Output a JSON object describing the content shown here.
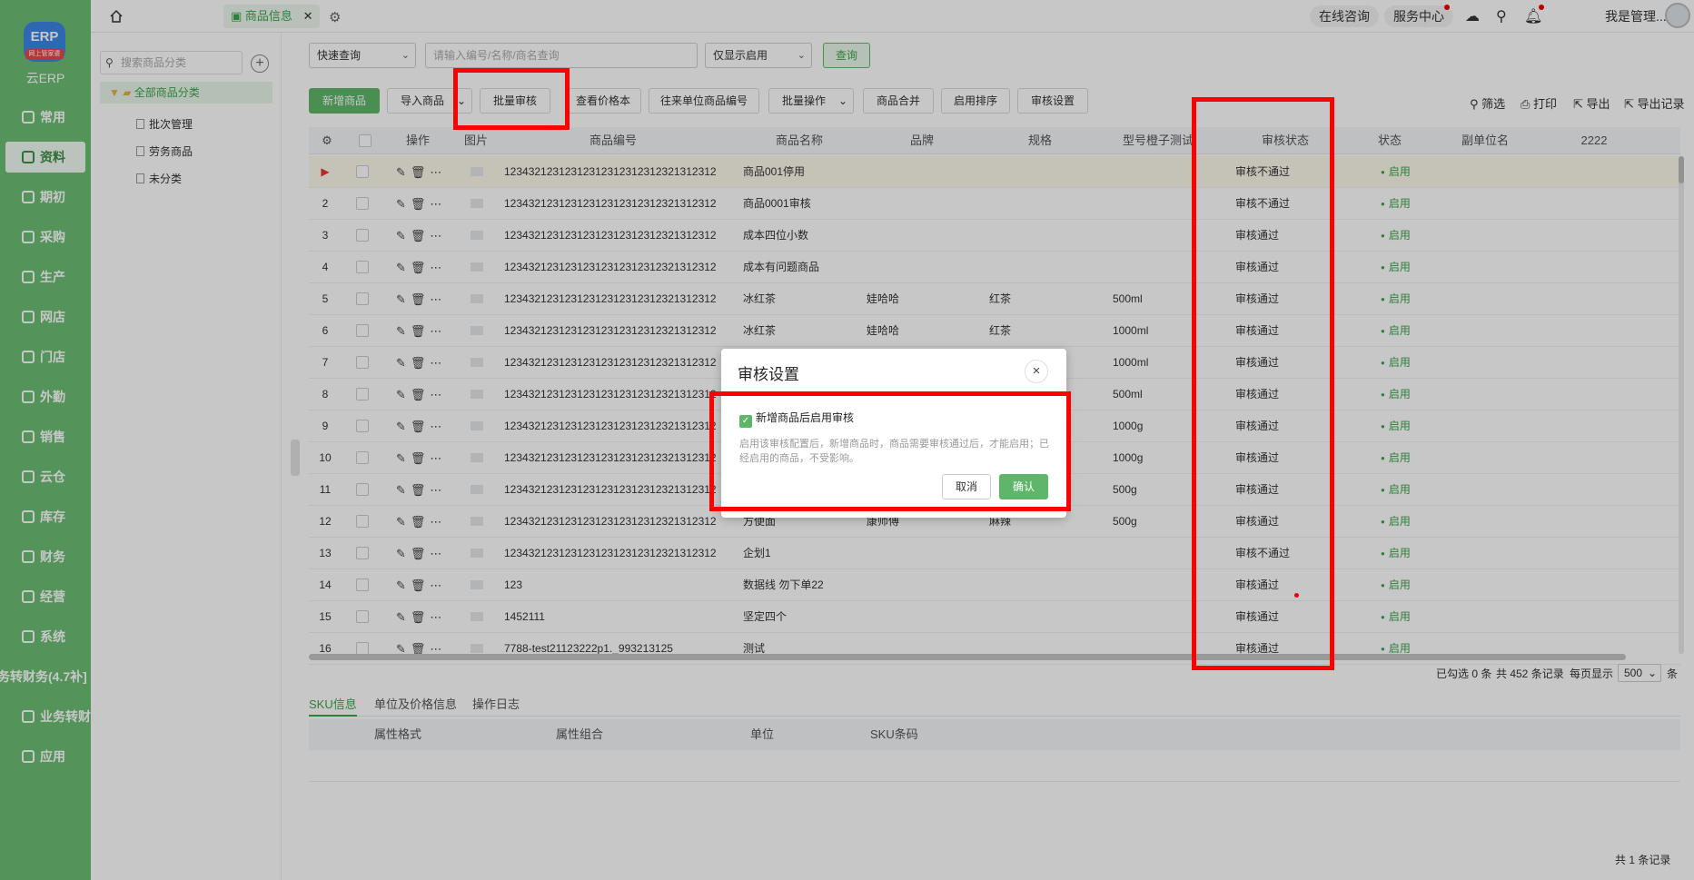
{
  "app": {
    "logo_text": "ERP",
    "logo_sub": "网上管家婆",
    "name": "云ERP"
  },
  "sidebar": {
    "items": [
      {
        "label": "常用",
        "icon": "star-icon"
      },
      {
        "label": "资料",
        "icon": "database-icon",
        "active": true
      },
      {
        "label": "期初",
        "icon": "clock-icon"
      },
      {
        "label": "采购",
        "icon": "cart-icon"
      },
      {
        "label": "生产",
        "icon": "factory-icon"
      },
      {
        "label": "网店",
        "icon": "store-icon"
      },
      {
        "label": "门店",
        "icon": "shop-icon"
      },
      {
        "label": "外勤",
        "icon": "location-icon"
      },
      {
        "label": "销售",
        "icon": "chart-icon"
      },
      {
        "label": "云仓",
        "icon": "warehouse-icon"
      },
      {
        "label": "库存",
        "icon": "home-icon"
      },
      {
        "label": "财务",
        "icon": "wallet-icon"
      },
      {
        "label": "经营",
        "icon": "trend-icon"
      },
      {
        "label": "系统",
        "icon": "settings-icon"
      },
      {
        "label": "务转财务(4.7补]",
        "icon": "none"
      },
      {
        "label": "业务转财务",
        "icon": "exchange-icon"
      },
      {
        "label": "应用",
        "icon": "plus-icon"
      }
    ]
  },
  "topbar": {
    "tab_label": "商品信息",
    "tab_close": "✕",
    "online_consult": "在线咨询",
    "service_center": "服务中心",
    "user_name": "我是管理..."
  },
  "category": {
    "search_placeholder": "搜索商品分类",
    "root": "全部商品分类",
    "children": [
      "批次管理",
      "劳务商品",
      "未分类"
    ]
  },
  "filter": {
    "quick_query": "快速查询",
    "search_placeholder": "请输入编号/名称/商名查询",
    "status_filter": "仅显示启用",
    "query_button": "查询"
  },
  "toolbar": {
    "buttons": [
      "新增商品",
      "导入商品",
      "批量审核",
      "查看价格本",
      "往来单位商品编号",
      "批量操作",
      "商品合并",
      "启用排序",
      "审核设置"
    ],
    "right": [
      "筛选",
      "打印",
      "导出",
      "导出记录"
    ]
  },
  "table": {
    "columns": [
      "操作",
      "图片",
      "商品编号",
      "商品名称",
      "品牌",
      "规格",
      "型号橙子测试",
      "审核状态",
      "状态",
      "副单位名",
      "2222"
    ],
    "rows": [
      {
        "no": "▶",
        "code": "12343212312312312312312312321312312",
        "name": "商品001停用",
        "brand": "",
        "spec": "",
        "model": "",
        "audit": "审核不通过",
        "status": "启用"
      },
      {
        "no": "2",
        "code": "12343212312312312312312312321312312",
        "name": "商品0001审核",
        "brand": "",
        "spec": "",
        "model": "",
        "audit": "审核不通过",
        "status": "启用"
      },
      {
        "no": "3",
        "code": "12343212312312312312312312321312312",
        "name": "成本四位小数",
        "brand": "",
        "spec": "",
        "model": "",
        "audit": "审核通过",
        "status": "启用"
      },
      {
        "no": "4",
        "code": "12343212312312312312312312321312312",
        "name": "成本有问题商品",
        "brand": "",
        "spec": "",
        "model": "",
        "audit": "审核通过",
        "status": "启用"
      },
      {
        "no": "5",
        "code": "12343212312312312312312312321312312",
        "name": "冰红茶",
        "brand": "娃哈哈",
        "spec": "红茶",
        "model": "500ml",
        "audit": "审核通过",
        "status": "启用"
      },
      {
        "no": "6",
        "code": "12343212312312312312312312321312312",
        "name": "冰红茶",
        "brand": "娃哈哈",
        "spec": "红茶",
        "model": "1000ml",
        "audit": "审核通过",
        "status": "启用"
      },
      {
        "no": "7",
        "code": "12343212312312312312312312321312312",
        "name": "",
        "brand": "",
        "spec": "",
        "model": "1000ml",
        "audit": "审核通过",
        "status": "启用"
      },
      {
        "no": "8",
        "code": "12343212312312312312312312321312312",
        "name": "",
        "brand": "",
        "spec": "",
        "model": "500ml",
        "audit": "审核通过",
        "status": "启用"
      },
      {
        "no": "9",
        "code": "12343212312312312312312312321312312",
        "name": "",
        "brand": "",
        "spec": "",
        "model": "1000g",
        "audit": "审核通过",
        "status": "启用"
      },
      {
        "no": "10",
        "code": "12343212312312312312312312321312312",
        "name": "",
        "brand": "",
        "spec": "",
        "model": "1000g",
        "audit": "审核通过",
        "status": "启用"
      },
      {
        "no": "11",
        "code": "12343212312312312312312312321312312",
        "name": "",
        "brand": "",
        "spec": "",
        "model": "500g",
        "audit": "审核通过",
        "status": "启用"
      },
      {
        "no": "12",
        "code": "12343212312312312312312312321312312",
        "name": "方便面",
        "brand": "康师傅",
        "spec": "麻辣",
        "model": "500g",
        "audit": "审核通过",
        "status": "启用"
      },
      {
        "no": "13",
        "code": "12343212312312312312312312321312312",
        "name": "企划1",
        "brand": "",
        "spec": "",
        "model": "",
        "audit": "审核不通过",
        "status": "启用"
      },
      {
        "no": "14",
        "code": "123",
        "name": "数据线 勿下单22",
        "brand": "",
        "spec": "",
        "model": "",
        "audit": "审核通过",
        "status": "启用"
      },
      {
        "no": "15",
        "code": "1452111",
        "name": "坚定四个",
        "brand": "",
        "spec": "",
        "model": "",
        "audit": "审核通过",
        "status": "启用"
      },
      {
        "no": "16",
        "code": "7788-test21123222p1._993213125",
        "name": "测试",
        "brand": "",
        "spec": "",
        "model": "",
        "audit": "审核通过",
        "status": "启用"
      }
    ]
  },
  "pager": {
    "selected": "已勾选 0 条",
    "total": "共 452 条记录",
    "per_page_label": "每页显示",
    "per_page": "500",
    "unit": "条"
  },
  "bottom": {
    "tabs": [
      "SKU信息",
      "单位及价格信息",
      "操作日志"
    ],
    "sku_columns": [
      "属性格式",
      "属性组合",
      "单位",
      "SKU条码"
    ],
    "total": "共 1 条记录"
  },
  "dialog": {
    "title": "审核设置",
    "close": "×",
    "checkbox_label": "新增商品后启用审核",
    "checked": true,
    "description": "启用该审核配置后，新增商品时，商品需要审核通过后，才能启用；已经启用的商品，不受影响。",
    "cancel": "取消",
    "confirm": "确认"
  },
  "colors": {
    "sidebar": "#6cbd74",
    "accent": "#3aa64a",
    "annotation": "#ff0000"
  }
}
